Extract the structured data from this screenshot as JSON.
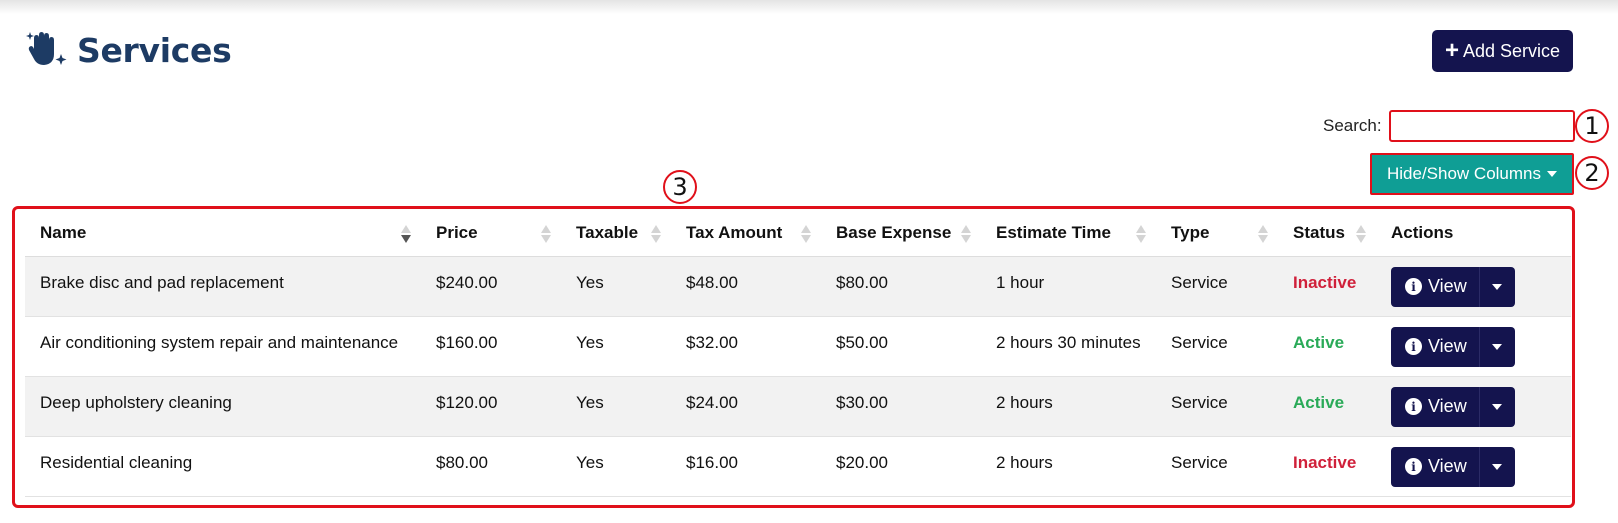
{
  "page": {
    "title": "Services",
    "icon": "hand-sparkle-icon"
  },
  "toolbar": {
    "add_label": "Add Service",
    "add_icon": "plus-icon",
    "columns_label": "Hide/Show Columns"
  },
  "search": {
    "label": "Search:",
    "value": "",
    "placeholder": ""
  },
  "callouts": [
    "1",
    "2",
    "3"
  ],
  "table": {
    "headers": [
      "Name",
      "Price",
      "Taxable",
      "Tax Amount",
      "Base Expense",
      "Estimate Time",
      "Type",
      "Status",
      "Actions"
    ],
    "sort": {
      "column": "Name",
      "direction": "desc"
    },
    "rows": [
      {
        "name": "Brake disc and pad replacement",
        "price": "$240.00",
        "taxable": "Yes",
        "tax_amount": "$48.00",
        "base_expense": "$80.00",
        "estimate_time": "1 hour",
        "type": "Service",
        "status": "Inactive",
        "action": "View"
      },
      {
        "name": "Air conditioning system repair and maintenance",
        "price": "$160.00",
        "taxable": "Yes",
        "tax_amount": "$32.00",
        "base_expense": "$50.00",
        "estimate_time": "2 hours 30 minutes",
        "type": "Service",
        "status": "Active",
        "action": "View"
      },
      {
        "name": "Deep upholstery cleaning",
        "price": "$120.00",
        "taxable": "Yes",
        "tax_amount": "$24.00",
        "base_expense": "$30.00",
        "estimate_time": "2 hours",
        "type": "Service",
        "status": "Active",
        "action": "View"
      },
      {
        "name": "Residential cleaning",
        "price": "$80.00",
        "taxable": "Yes",
        "tax_amount": "$16.00",
        "base_expense": "$20.00",
        "estimate_time": "2 hours",
        "type": "Service",
        "status": "Inactive",
        "action": "View"
      }
    ]
  },
  "colors": {
    "brand_navy": "#14144e",
    "title_blue": "#1d3b64",
    "teal": "#0f9e95",
    "inactive": "#d0203a",
    "active": "#2aaa58",
    "highlight": "#e0101a"
  }
}
